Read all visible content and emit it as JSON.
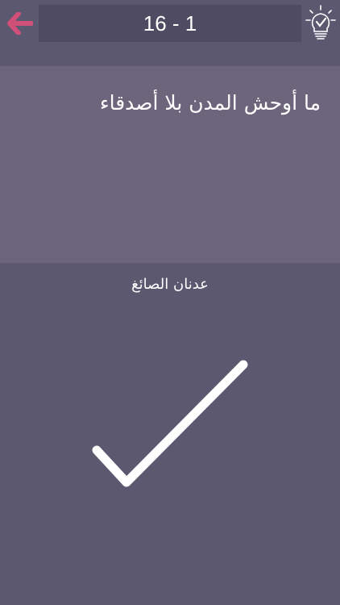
{
  "header": {
    "level_label": "16 - 1",
    "back_icon": "arrow-left-icon",
    "hint_icon": "lightbulb-check-icon",
    "accent_color": "#d0507a"
  },
  "quote": {
    "text": "ما أوحش المدن بلا أصدقاء",
    "author": "عدنان الصائغ"
  },
  "result": {
    "icon": "checkmark-icon",
    "state": "correct"
  }
}
